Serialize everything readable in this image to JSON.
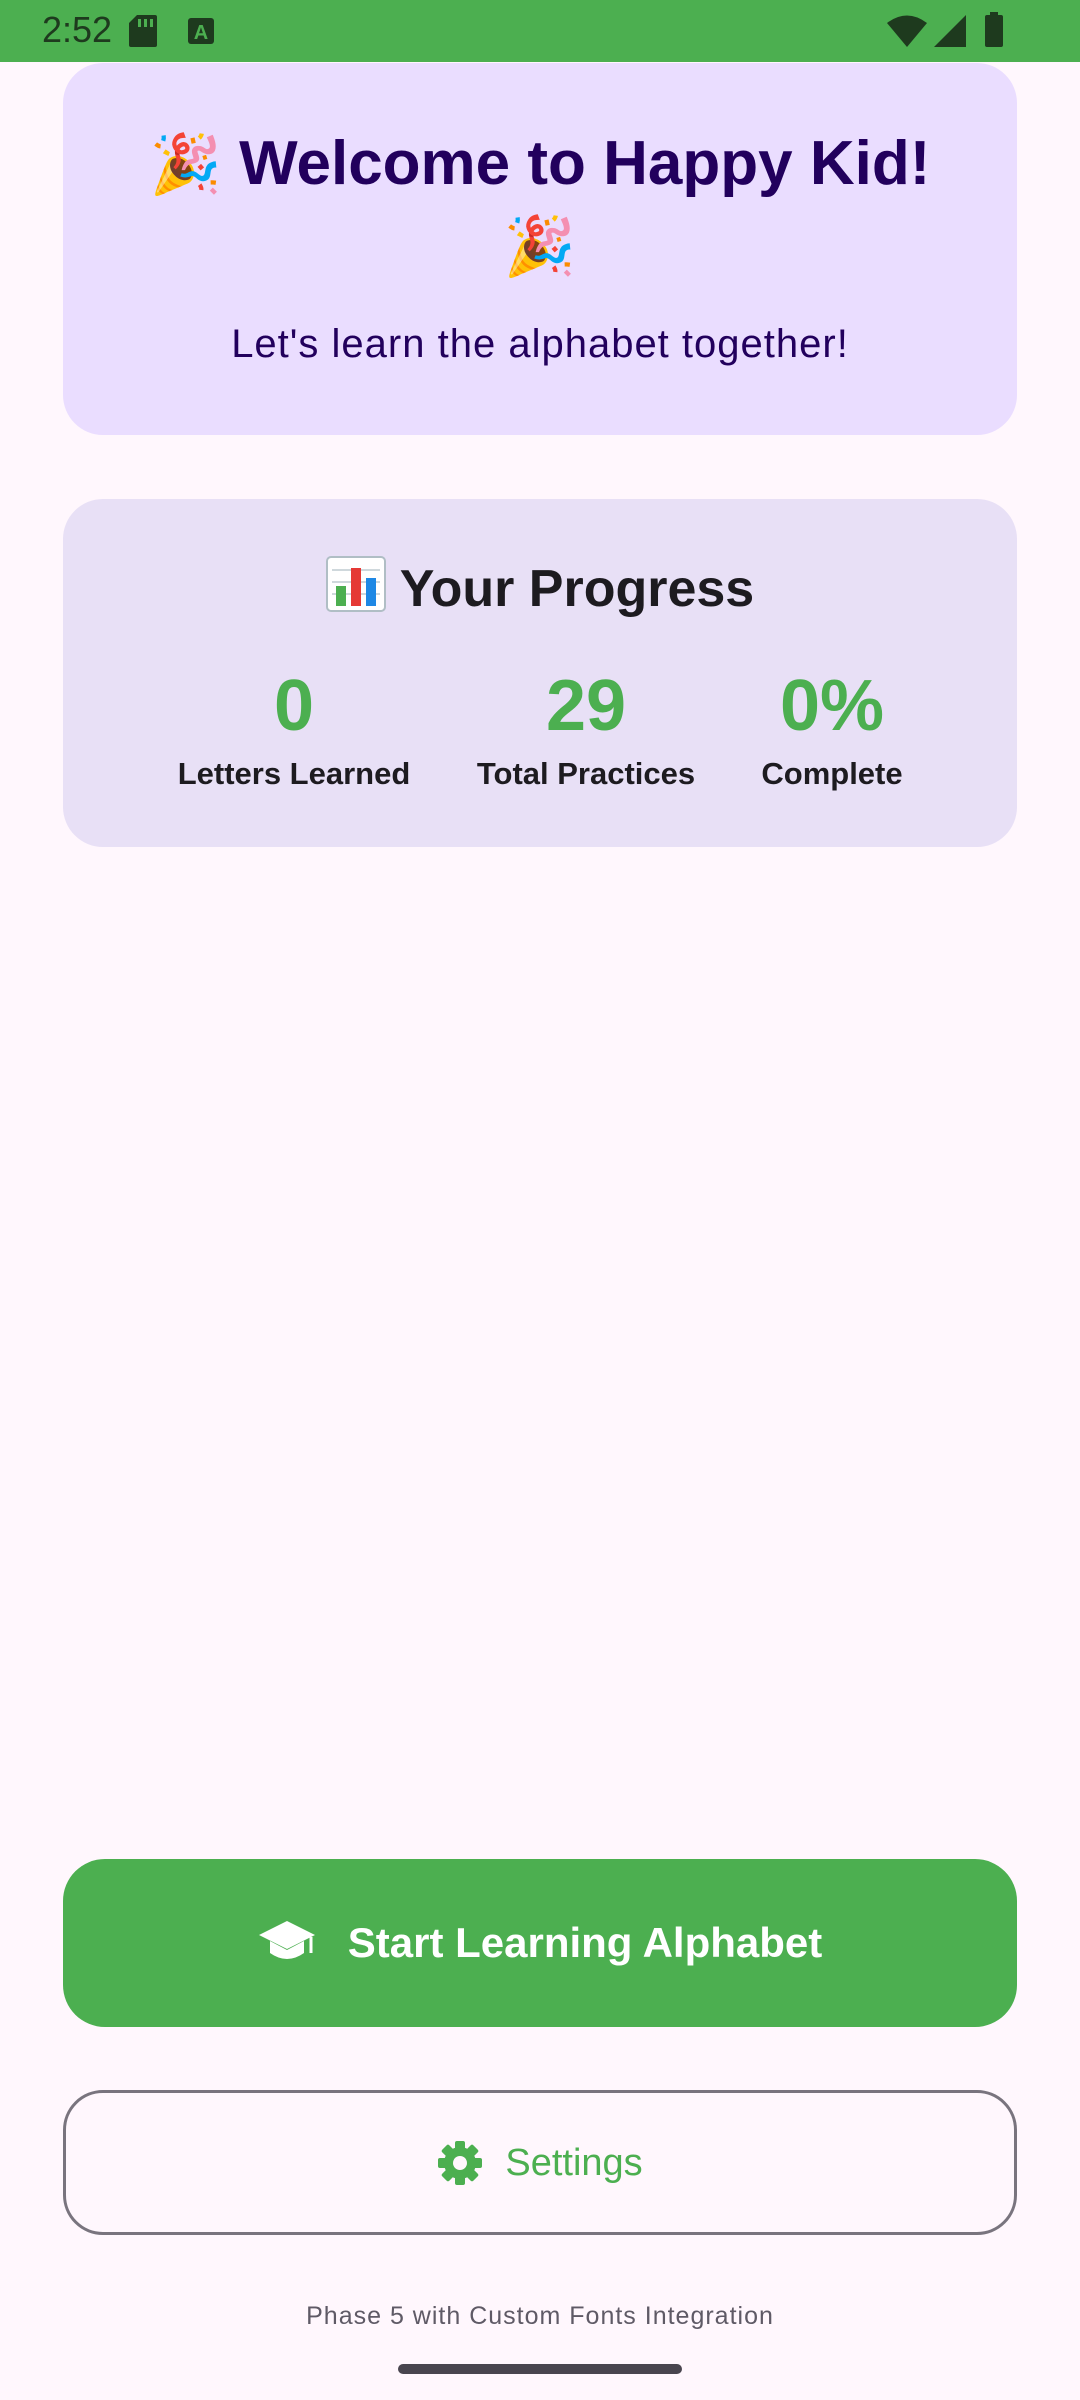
{
  "status_bar": {
    "time": "2:52",
    "icons": [
      "sd-card-icon",
      "font-app-icon",
      "wifi-icon",
      "signal-icon",
      "battery-icon"
    ]
  },
  "welcome": {
    "emoji": "🎉",
    "title": "Welcome to Happy Kid!",
    "subtitle": "Let's learn the alphabet together!"
  },
  "progress": {
    "title": "Your Progress",
    "icon": "bar-chart-icon",
    "stats": [
      {
        "value": "0",
        "label": "Letters Learned"
      },
      {
        "value": "29",
        "label": "Total Practices"
      },
      {
        "value": "0%",
        "label": "Complete"
      }
    ]
  },
  "actions": {
    "primary_label": "Start Learning Alphabet",
    "primary_icon": "graduation-cap-icon",
    "settings_label": "Settings",
    "settings_icon": "gear-icon"
  },
  "footer": {
    "note": "Phase 5 with Custom Fonts Integration"
  },
  "colors": {
    "accent_green": "#4CAF50",
    "welcome_card": "#EADDFF",
    "progress_card": "#E8E0F6",
    "background": "#FFF7FD",
    "title_purple": "#22005D"
  }
}
